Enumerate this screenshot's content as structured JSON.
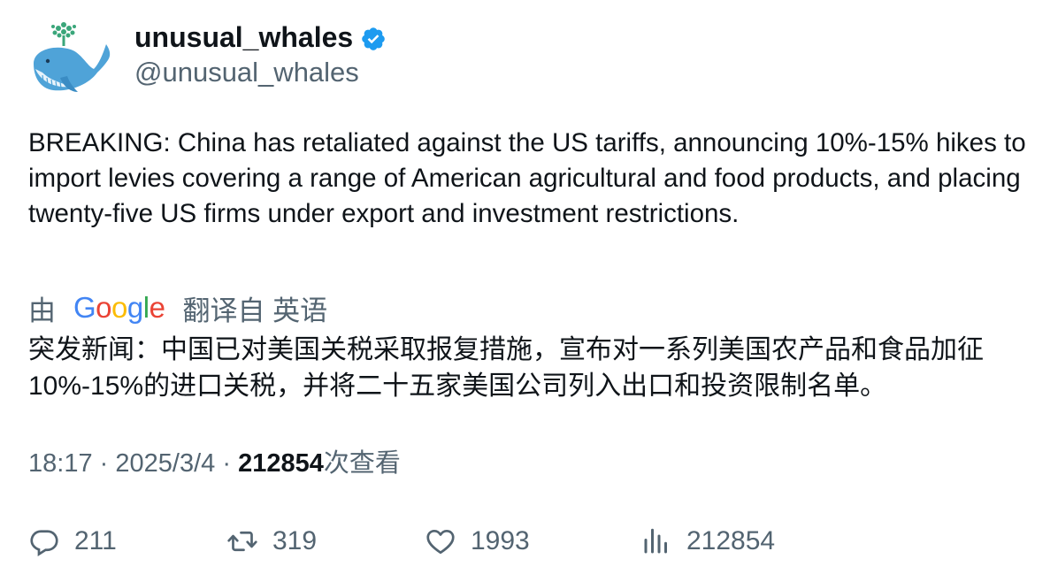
{
  "author": {
    "display_name": "unusual_whales",
    "handle": "@unusual_whales",
    "verified": true,
    "avatar_icon": "whale-icon",
    "verified_color": "#1d9bf0"
  },
  "tweet": {
    "text": "BREAKING: China has retaliated against the US tariffs, announcing 10%-15% hikes to import levies covering a range of American agricultural and food products, and placing twenty-five US firms under export and investment restrictions."
  },
  "translation": {
    "prefix": "由",
    "provider": "Google",
    "suffix": "翻译自 英语",
    "text": "突发新闻：中国已对美国关税采取报复措施，宣布对一系列美国农产品和食品加征10%-15%的进口关税，并将二十五家美国公司列入出口和投资限制名单。"
  },
  "meta": {
    "time": "18:17",
    "separator": "·",
    "date": "2025/3/4",
    "views_count": "212854",
    "views_label": "次查看"
  },
  "actions": {
    "reply_count": "211",
    "retweet_count": "319",
    "like_count": "1993",
    "views_count": "212854"
  },
  "colors": {
    "text_primary": "#0f1419",
    "text_secondary": "#536471",
    "google_blue": "#4285f4",
    "google_red": "#ea4335",
    "google_yellow": "#fbbc05",
    "google_green": "#34a853"
  }
}
